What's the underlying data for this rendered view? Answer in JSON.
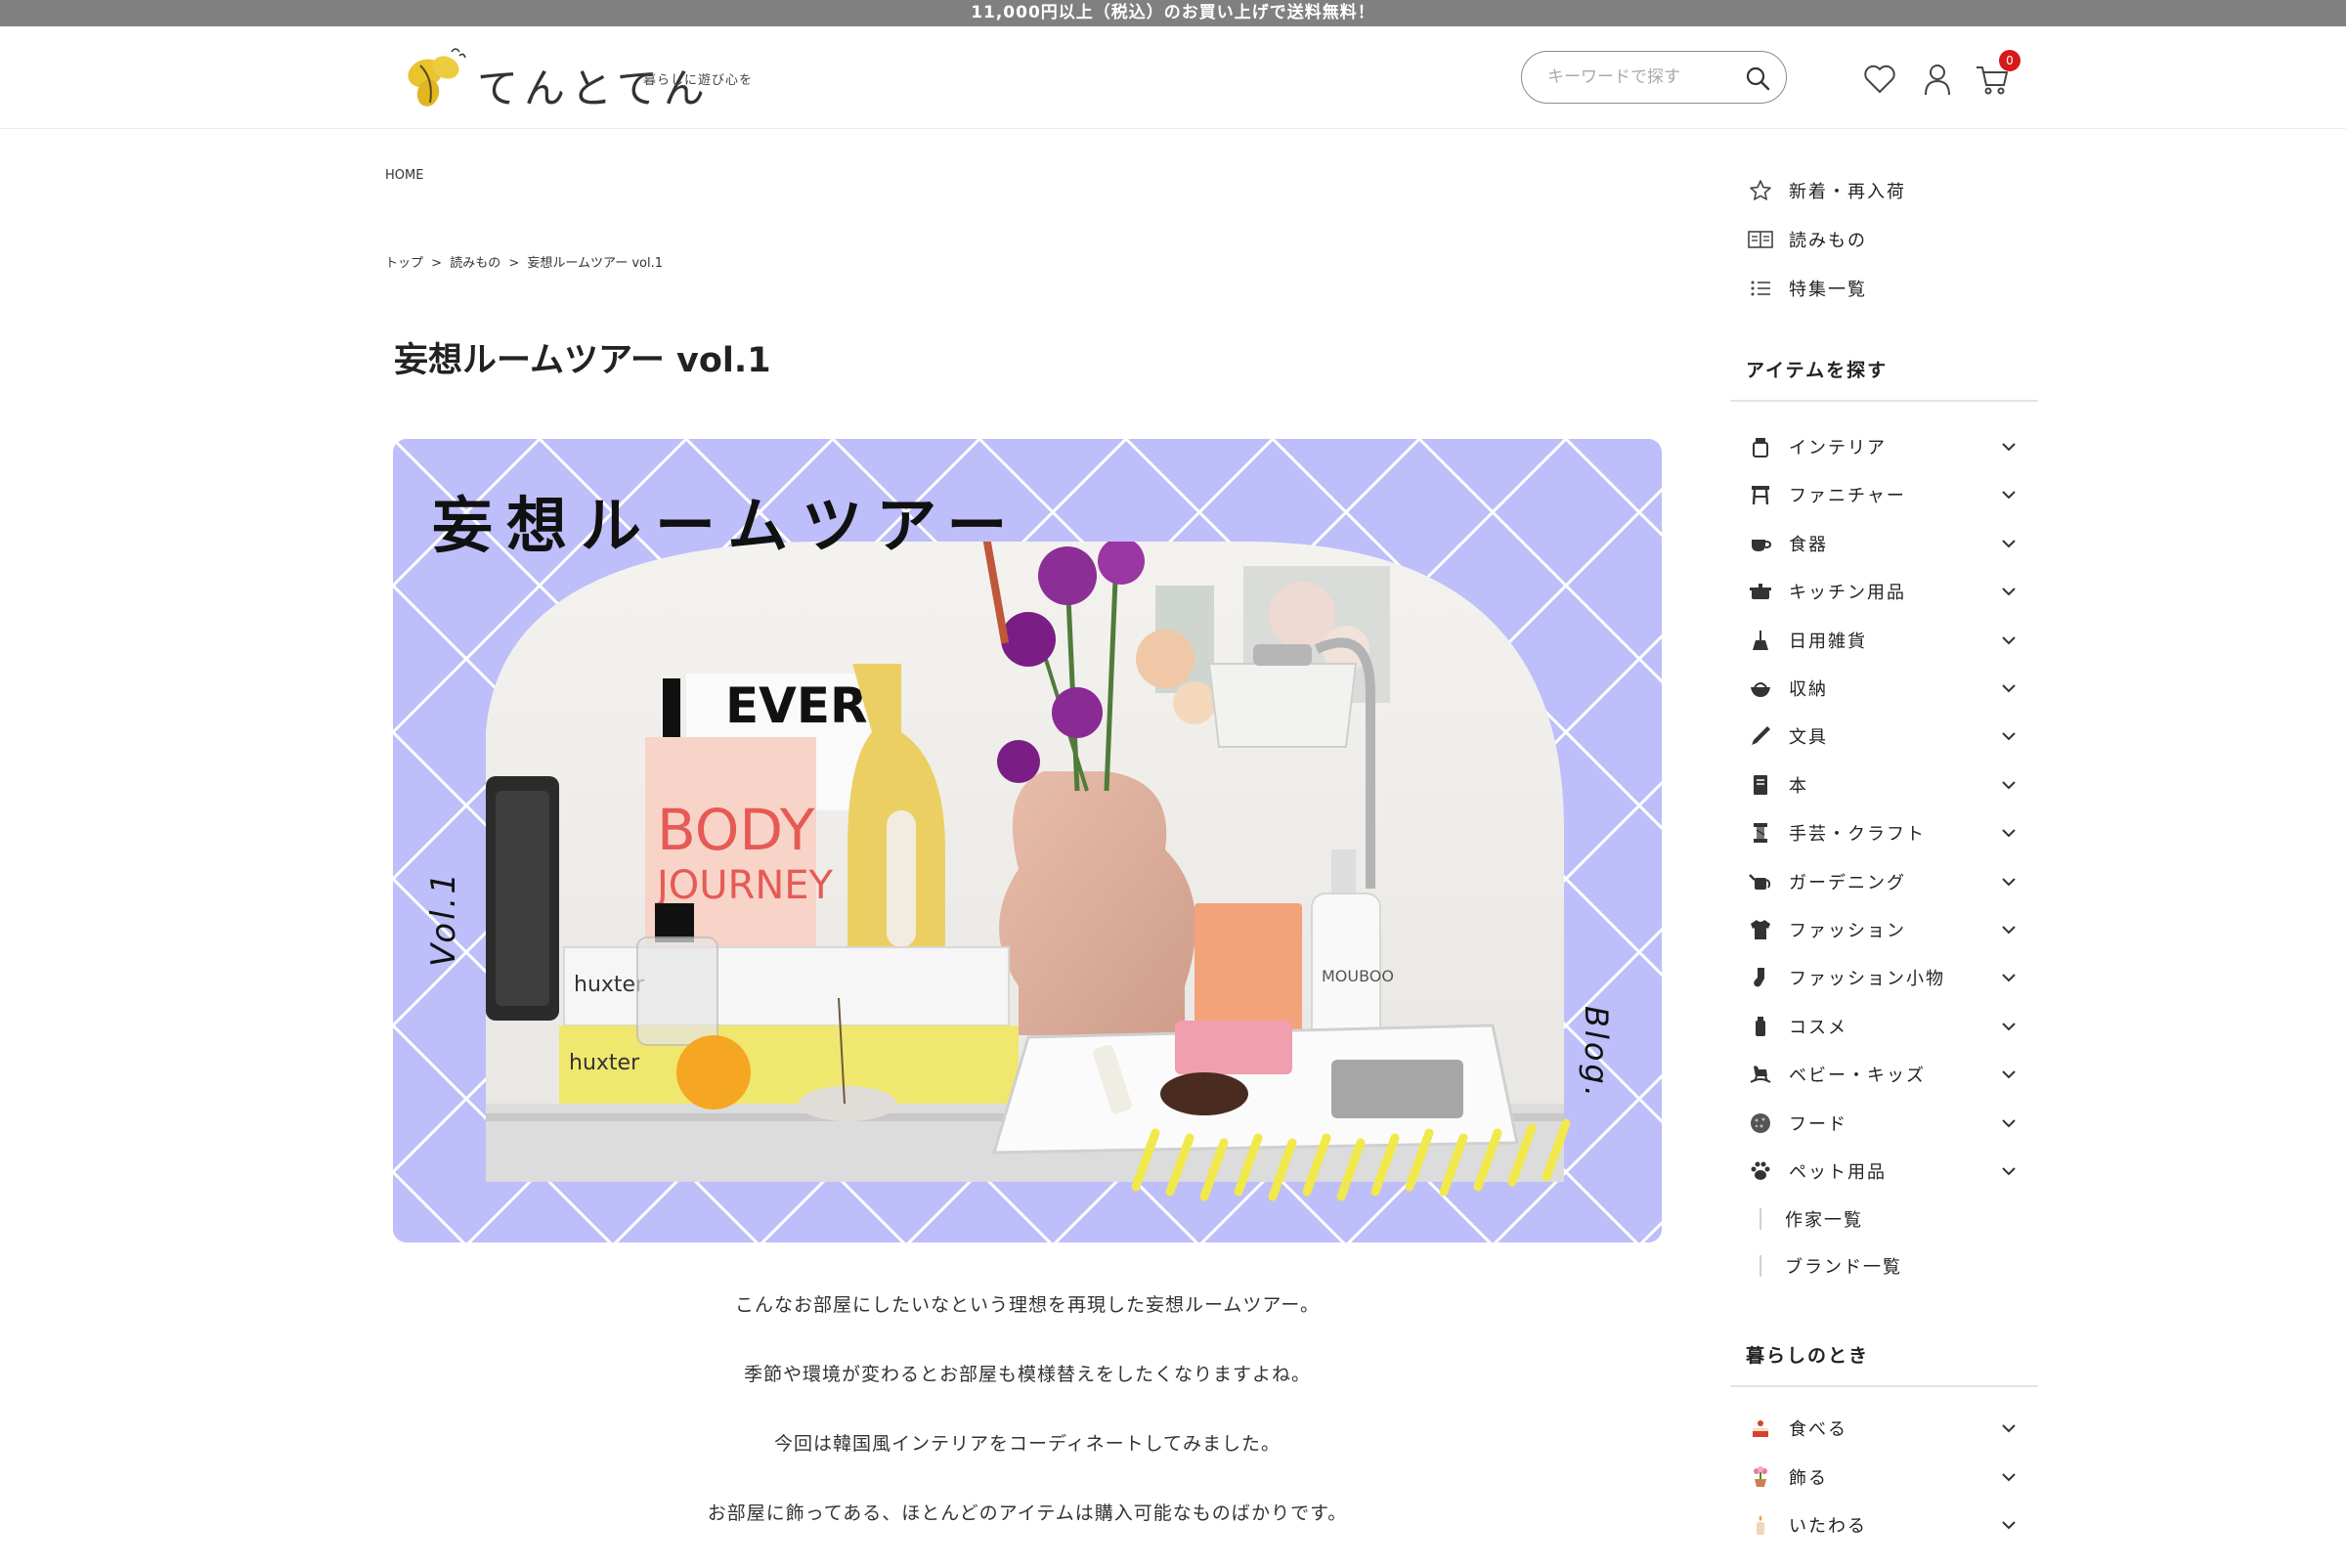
{
  "announcement": "11,000円以上（税込）のお買い上げで送料無料！",
  "header": {
    "logo_text": "てんとてん",
    "tagline": "暮らしに遊び心を",
    "search_placeholder": "キーワードで探す",
    "cart_count": "0"
  },
  "home_label": "HOME",
  "breadcrumb": [
    "トップ",
    "読みもの",
    "妄想ルームツアー vol.1"
  ],
  "breadcrumb_sep": ">",
  "page_title": "妄想ルームツアー vol.1",
  "hero": {
    "title": "妄想ルームツアー",
    "vol": "Vol.1",
    "blog": "Blog.",
    "book_title_1": "EVERY",
    "book_title_2": "BODY",
    "book_title_3": "JOURNEY",
    "box_brand": "huxter",
    "candle_brand": "MOUBOO",
    "colors": {
      "background": "#bdbefa",
      "lines": "#ffffff",
      "accent_yellow": "#f1e84c"
    }
  },
  "body_paragraphs": [
    "こんなお部屋にしたいなという理想を再現した妄想ルームツアー。",
    "季節や環境が変わるとお部屋も模様替えをしたくなりますよね。",
    "今回は韓国風インテリアをコーディネートしてみました。",
    "お部屋に飾ってある、ほとんどのアイテムは購入可能なものばかりです。"
  ],
  "sidebar": {
    "top_links": [
      {
        "icon": "star-icon",
        "label": "新着・再入荷"
      },
      {
        "icon": "book-open-icon",
        "label": "読みもの"
      },
      {
        "icon": "list-icon",
        "label": "特集一覧"
      }
    ],
    "items_title": "アイテムを探す",
    "categories": [
      {
        "icon": "jar-icon",
        "label": "インテリア"
      },
      {
        "icon": "stool-icon",
        "label": "ファニチャー"
      },
      {
        "icon": "cup-icon",
        "label": "食器"
      },
      {
        "icon": "pot-icon",
        "label": "キッチン用品"
      },
      {
        "icon": "broom-icon",
        "label": "日用雑貨"
      },
      {
        "icon": "basket-icon",
        "label": "収納"
      },
      {
        "icon": "pen-icon",
        "label": "文具"
      },
      {
        "icon": "notebook-icon",
        "label": "本"
      },
      {
        "icon": "thread-icon",
        "label": "手芸・クラフト"
      },
      {
        "icon": "watering-can-icon",
        "label": "ガーデニング"
      },
      {
        "icon": "shirt-icon",
        "label": "ファッション"
      },
      {
        "icon": "sock-icon",
        "label": "ファッション小物"
      },
      {
        "icon": "bottle-icon",
        "label": "コスメ"
      },
      {
        "icon": "rocking-horse-icon",
        "label": "ベビー・キッズ"
      },
      {
        "icon": "cookie-icon",
        "label": "フード"
      },
      {
        "icon": "paw-icon",
        "label": "ペット用品"
      }
    ],
    "sub_links": [
      "作家一覧",
      "ブランド一覧"
    ],
    "life_title": "暮らしのとき",
    "life": [
      {
        "icon": "cake-icon",
        "label": "食べる"
      },
      {
        "icon": "flower-pot-icon",
        "label": "飾る"
      },
      {
        "icon": "candle-icon",
        "label": "いたわる"
      }
    ]
  }
}
